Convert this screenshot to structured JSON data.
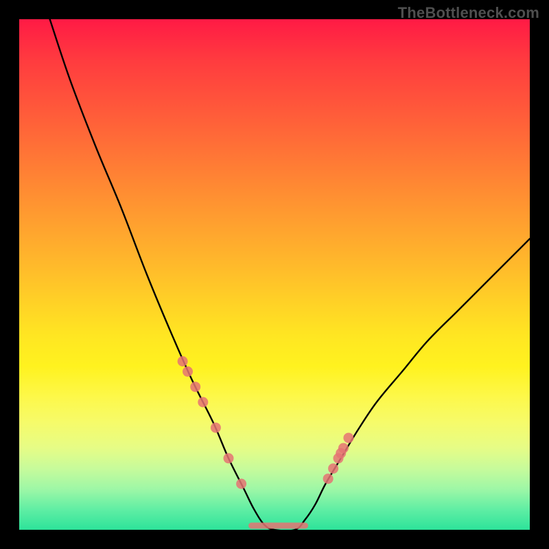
{
  "watermark": "TheBottleneck.com",
  "colors": {
    "marker": "#e57373",
    "curve": "#000000",
    "frame": "#000000"
  },
  "chart_data": {
    "type": "line",
    "title": "",
    "xlabel": "",
    "ylabel": "",
    "xlim": [
      0,
      100
    ],
    "ylim": [
      0,
      100
    ],
    "grid": false,
    "legend": false,
    "series": [
      {
        "name": "bottleneck-curve",
        "x": [
          6,
          10,
          15,
          20,
          25,
          30,
          34,
          38,
          41,
          44,
          46,
          48,
          50,
          54,
          56,
          58,
          60,
          63,
          66,
          70,
          75,
          80,
          86,
          92,
          100
        ],
        "y": [
          100,
          88,
          75,
          63,
          50,
          38,
          29,
          21,
          14,
          8,
          4,
          1,
          0,
          0,
          2,
          5,
          9,
          14,
          19,
          25,
          31,
          37,
          43,
          49,
          57
        ]
      }
    ],
    "markers": {
      "name": "highlight-points",
      "x": [
        32,
        33,
        34.5,
        36,
        38.5,
        41,
        43.5,
        60.5,
        61.5,
        62.5,
        63,
        63.5,
        64.5
      ],
      "y": [
        33,
        31,
        28,
        25,
        20,
        14,
        9,
        10,
        12,
        14,
        15,
        16,
        18
      ]
    },
    "flat_segment": {
      "x0": 45.5,
      "x1": 56,
      "y": 0.8
    }
  }
}
